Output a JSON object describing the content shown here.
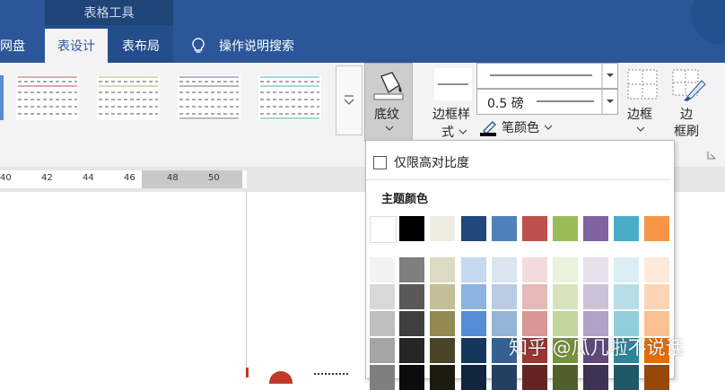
{
  "contextual_tab_title": "表格工具",
  "tabs": [
    {
      "label": "度网盘",
      "active": false
    },
    {
      "label": "表设计",
      "active": true
    },
    {
      "label": "表布局",
      "active": false
    },
    {
      "label": "操作说明搜索",
      "active": false,
      "icon": "lightbulb-icon"
    }
  ],
  "ribbon": {
    "shading_label": "底纹",
    "border_styles_label_1": "边框样",
    "border_styles_label_2": "式",
    "pen_weight": "0.5 磅",
    "pen_color_label": "笔颜色",
    "borders_label": "边框",
    "painter_label_1": "边",
    "painter_label_2": "框刷"
  },
  "ruler_ticks": [
    "40",
    "42",
    "44",
    "46",
    "48",
    "50"
  ],
  "dropdown": {
    "high_contrast_label": "仅限高对比度",
    "high_contrast_checked": false,
    "theme_colors_heading": "主题颜色",
    "theme_colors": [
      "#ffffff",
      "#000000",
      "#eeece1",
      "#1f497d",
      "#4f81bd",
      "#c0504d",
      "#9bbb59",
      "#8064a2",
      "#4bacc6",
      "#f79646"
    ],
    "tints": [
      [
        "#f2f2f2",
        "#7f7f7f",
        "#ddd9c3",
        "#c6d9f0",
        "#dbe5f1",
        "#f2dcdb",
        "#ebf1dd",
        "#e5e0ec",
        "#dbeef3",
        "#fdeada"
      ],
      [
        "#d8d8d8",
        "#595959",
        "#c4bd97",
        "#8db3e2",
        "#b8cce4",
        "#e5b9b7",
        "#d7e3bc",
        "#ccc1d9",
        "#b7dde8",
        "#fbd5b5"
      ],
      [
        "#bfbfbf",
        "#3f3f3f",
        "#938953",
        "#548dd4",
        "#95b3d7",
        "#d99694",
        "#c3d69b",
        "#b2a2c7",
        "#92cddc",
        "#fac08f"
      ],
      [
        "#a5a5a5",
        "#262626",
        "#494429",
        "#17365d",
        "#366092",
        "#953734",
        "#76923c",
        "#5f497a",
        "#31859b",
        "#e36c09"
      ],
      [
        "#7f7f7f",
        "#0c0c0c",
        "#1d1b10",
        "#0f243e",
        "#244061",
        "#632423",
        "#4f6128",
        "#3f3151",
        "#205867",
        "#974806"
      ]
    ]
  },
  "watermark": "知乎 @瓜几啦不说话",
  "colors": {
    "ribbon_blue": "#2b579a",
    "ribbon_bg": "#f3f3f3"
  }
}
